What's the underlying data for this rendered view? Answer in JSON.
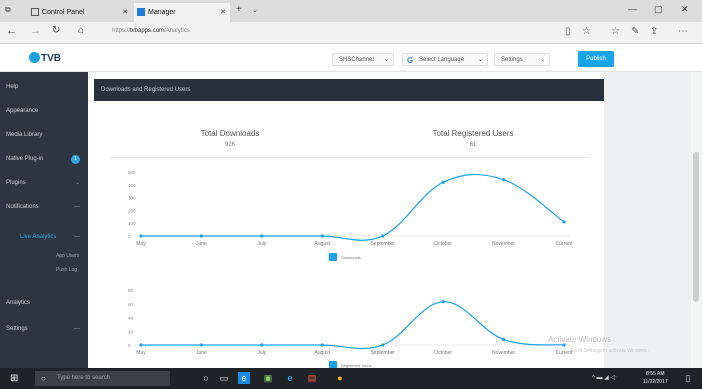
{
  "browser": {
    "tabs": [
      {
        "label": "Control Panel",
        "active": false
      },
      {
        "label": "Manager",
        "active": true
      }
    ],
    "new_tab": "+",
    "url_prefix": "https://",
    "url_domain": "tvbapps.com",
    "url_path": "/Analytics",
    "window_controls": [
      "—",
      "▢",
      "✕"
    ]
  },
  "app": {
    "logo_text": "TVB",
    "header": {
      "network_select": "SHSChannel",
      "language_select": "Select Language",
      "user_select": "Settings",
      "publish_button": "Publish",
      "google_g": "G"
    },
    "sidebar": {
      "items": [
        {
          "label": "Help",
          "type": "item"
        },
        {
          "label": "Appearance",
          "type": "item"
        },
        {
          "label": "Media Library",
          "type": "item"
        },
        {
          "label": "Native Plug-in",
          "type": "item",
          "badge": "1"
        },
        {
          "label": "Plugins",
          "type": "item",
          "chevron": "⌄"
        },
        {
          "label": "Notifications",
          "type": "item",
          "chevron": "—"
        },
        {
          "label": "Live Analytics",
          "type": "active",
          "chevron": "—"
        },
        {
          "label": "App Users",
          "type": "sub"
        },
        {
          "label": "Push Log",
          "type": "sub"
        },
        {
          "label": "Analytics",
          "type": "item"
        },
        {
          "label": "Settings",
          "type": "item",
          "chevron": "—"
        }
      ]
    },
    "section_title": "Downloads and Registered Users",
    "stats": {
      "downloads_label": "Total Downloads",
      "downloads_value": "926",
      "users_label": "Total Registered Users",
      "users_value": "61"
    },
    "watermark_title": "Activate Windows",
    "watermark_sub": "Go to Settings to activate Windows."
  },
  "chart_data": [
    {
      "type": "line",
      "categories": [
        "May",
        "June",
        "July",
        "August",
        "September",
        "October",
        "November",
        "Current"
      ],
      "series": [
        {
          "name": "Downloads",
          "values": [
            0,
            0,
            0,
            0,
            0,
            420,
            440,
            110
          ],
          "color": "#1aa1e8"
        }
      ],
      "yticks": [
        0,
        100,
        200,
        300,
        400,
        500
      ],
      "ylim": [
        0,
        500
      ],
      "legend_position": "bottom"
    },
    {
      "type": "line",
      "categories": [
        "May",
        "June",
        "July",
        "August",
        "September",
        "October",
        "November",
        "Current"
      ],
      "series": [
        {
          "name": "Registered Users",
          "values": [
            0,
            0,
            0,
            0,
            0,
            63,
            8,
            0
          ],
          "color": "#1aa1e8"
        }
      ],
      "yticks": [
        0,
        20,
        40,
        60,
        80
      ],
      "ylim": [
        0,
        80
      ],
      "legend_position": "bottom"
    }
  ],
  "taskbar": {
    "search_placeholder": "Type here to search",
    "time": "8:55 AM",
    "date": "11/22/2017"
  }
}
